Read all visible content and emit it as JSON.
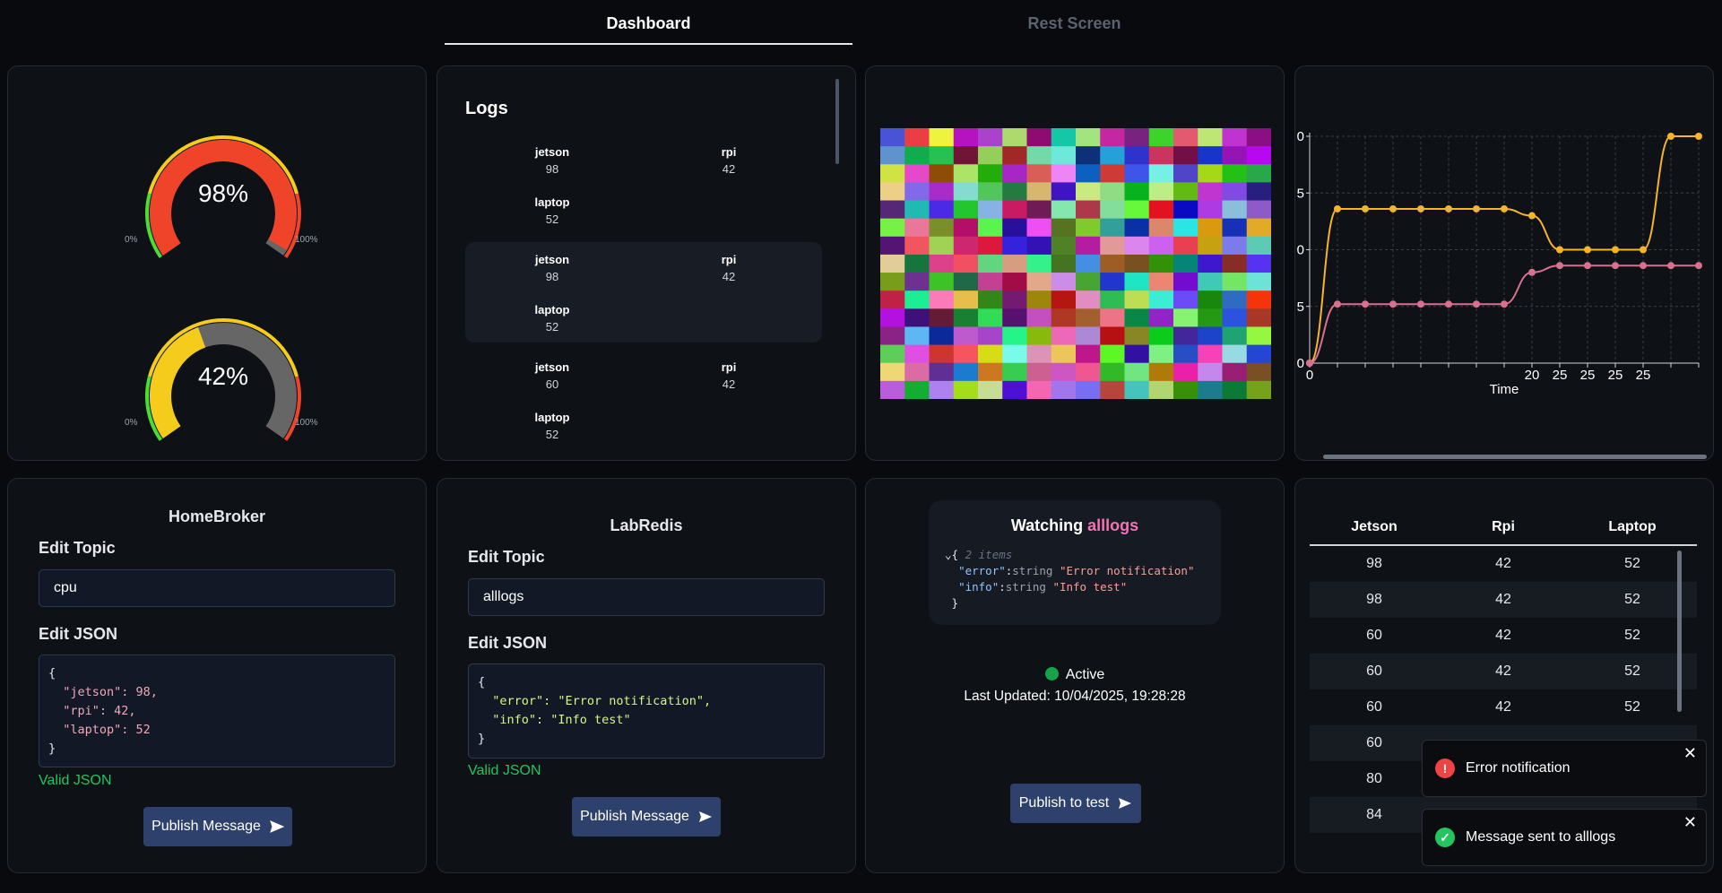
{
  "tabs": {
    "dashboard": "Dashboard",
    "rest": "Rest Screen"
  },
  "gauges": [
    {
      "value": 98,
      "label": "98%",
      "min": "0%",
      "max": "100%",
      "color": "#f0442a"
    },
    {
      "value": 42,
      "label": "42%",
      "min": "0%",
      "max": "100%",
      "color": "#f5cc1b"
    }
  ],
  "logs": {
    "title": "Logs",
    "entries": [
      {
        "jetson_label": "jetson",
        "jetson": "98",
        "rpi_label": "rpi",
        "rpi": "42",
        "laptop_label": "laptop",
        "laptop": "52"
      },
      {
        "jetson_label": "jetson",
        "jetson": "98",
        "rpi_label": "rpi",
        "rpi": "42",
        "laptop_label": "laptop",
        "laptop": "52"
      },
      {
        "jetson_label": "jetson",
        "jetson": "60",
        "rpi_label": "rpi",
        "rpi": "42",
        "laptop_label": "laptop",
        "laptop": "52"
      }
    ]
  },
  "line_chart": {
    "xlabel": "Time",
    "x_tick_labels": [
      "0",
      "20",
      "25",
      "25",
      "25",
      "25"
    ],
    "y_tick_labels": [
      "0",
      "5",
      "0",
      "5",
      "0"
    ],
    "colors": {
      "a": "#f5b42a",
      "b": "#d97092"
    }
  },
  "chart_data": {
    "type": "line",
    "xlabel": "Time",
    "series": [
      {
        "values": [
          0,
          68,
          68,
          68,
          68,
          68,
          68,
          68,
          65,
          50,
          50,
          50,
          50,
          100,
          100
        ]
      },
      {
        "values": [
          0,
          26,
          26,
          26,
          26,
          26,
          26,
          26,
          40,
          43,
          43,
          43,
          43,
          43,
          43
        ]
      }
    ],
    "ylim": [
      0,
      100
    ]
  },
  "brokers": [
    {
      "title": "HomeBroker",
      "topic_label": "Edit Topic",
      "topic": "cpu",
      "json_label": "Edit JSON",
      "json_lines": [
        "{",
        "  \"jetson\": 98,",
        "  \"rpi\": 42,",
        "  \"laptop\": 52",
        "}"
      ],
      "valid": "Valid JSON",
      "button": "Publish Message"
    },
    {
      "title": "LabRedis",
      "topic_label": "Edit Topic",
      "topic": "alllogs",
      "json_label": "Edit JSON",
      "json_lines": [
        "{",
        "  \"error\": \"Error notification\",",
        "  \"info\": \"Info test\"",
        "}"
      ],
      "valid": "Valid JSON",
      "button": "Publish Message"
    }
  ],
  "watch": {
    "title_prefix": "Watching",
    "topic": "alllogs",
    "count": "2 items",
    "items": [
      {
        "key": "\"error\"",
        "type": "string",
        "value": "\"Error notification\""
      },
      {
        "key": "\"info\"",
        "type": "string",
        "value": "\"Info test\""
      }
    ],
    "status": "Active",
    "updated": "Last Updated: 10/04/2025, 19:28:28",
    "button": "Publish to test"
  },
  "table": {
    "headers": [
      "Jetson",
      "Rpi",
      "Laptop"
    ],
    "rows": [
      [
        "98",
        "42",
        "52"
      ],
      [
        "98",
        "42",
        "52"
      ],
      [
        "60",
        "42",
        "52"
      ],
      [
        "60",
        "42",
        "52"
      ],
      [
        "60",
        "42",
        "52"
      ],
      [
        "60",
        "",
        ""
      ],
      [
        "80",
        "",
        ""
      ],
      [
        "84",
        "",
        ""
      ]
    ]
  },
  "toasts": [
    {
      "message": "Error notification",
      "type": "error",
      "color": "#ef4444"
    },
    {
      "message": "Message sent to alllogs",
      "type": "success",
      "color": "#22c55e"
    }
  ]
}
